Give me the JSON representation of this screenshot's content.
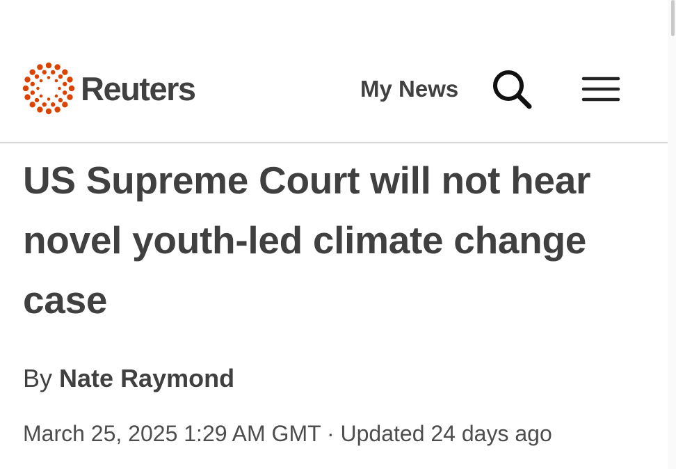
{
  "header": {
    "brand": "Reuters",
    "my_news_label": "My News",
    "search_icon": "search-icon",
    "menu_icon": "hamburger-menu-icon",
    "brand_color": "#dc4300",
    "text_color": "#404040"
  },
  "article": {
    "headline": "US Supreme Court will not hear novel youth-led climate change case",
    "byline_prefix": "By",
    "author": "Nate Raymond",
    "published": "March 25, 2025 1:29 AM GMT",
    "separator": "·",
    "updated": "Updated 24 days ago"
  }
}
